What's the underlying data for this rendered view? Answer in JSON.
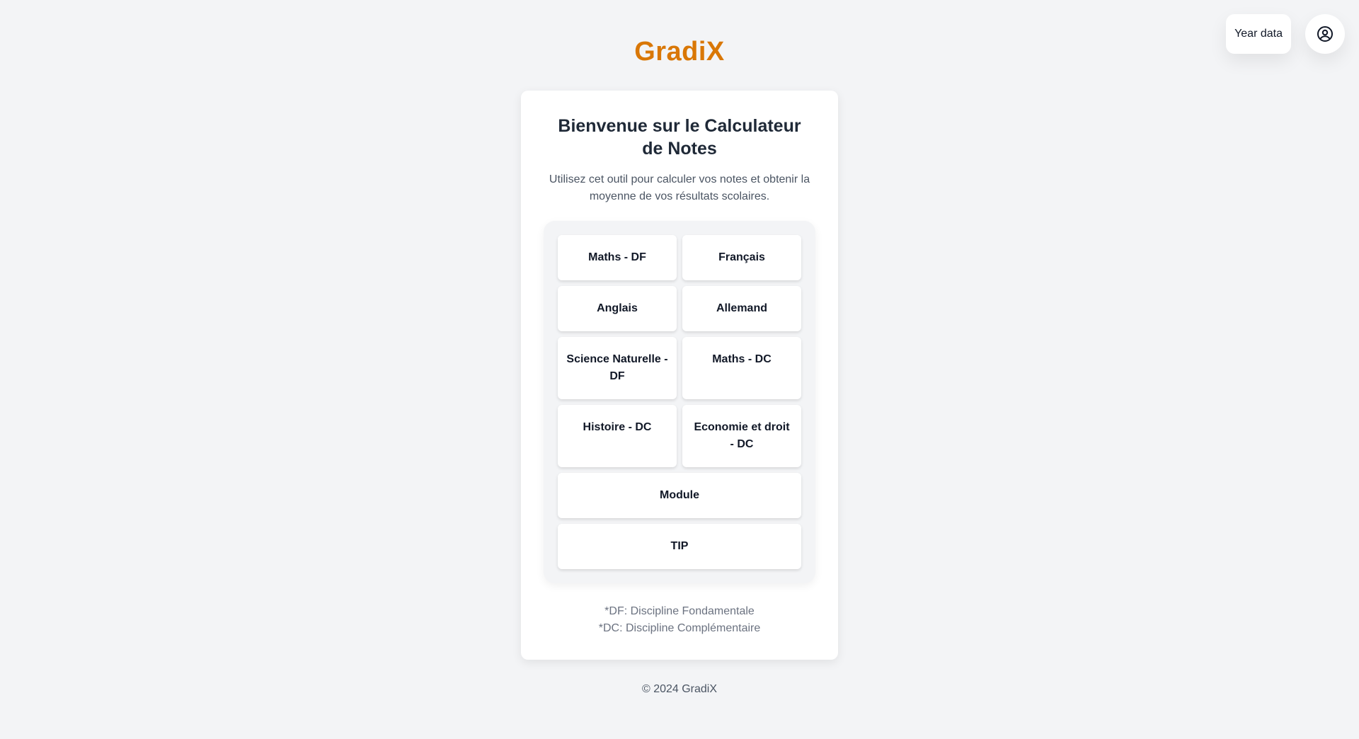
{
  "topbar": {
    "year_data_label": "Year data",
    "profile_icon": "user-circle-icon"
  },
  "brand": {
    "name": "GradiX"
  },
  "card": {
    "title": "Bienvenue sur le Calculateur de Notes",
    "description": "Utilisez cet outil pour calculer vos notes et obtenir la moyenne de vos résultats scolaires.",
    "subjects": [
      "Maths - DF",
      "Français",
      "Anglais",
      "Allemand",
      "Science Naturelle - DF",
      "Maths - DC",
      "Histoire - DC",
      "Economie et droit - DC",
      "Module",
      "TIP"
    ],
    "legend": {
      "df": "*DF: Discipline Fondamentale",
      "dc": "*DC: Discipline Complémentaire"
    }
  },
  "footer": {
    "text": "© 2024 GradiX"
  },
  "colors": {
    "accent": "#d97706",
    "background": "#f3f4f6",
    "card": "#ffffff"
  }
}
